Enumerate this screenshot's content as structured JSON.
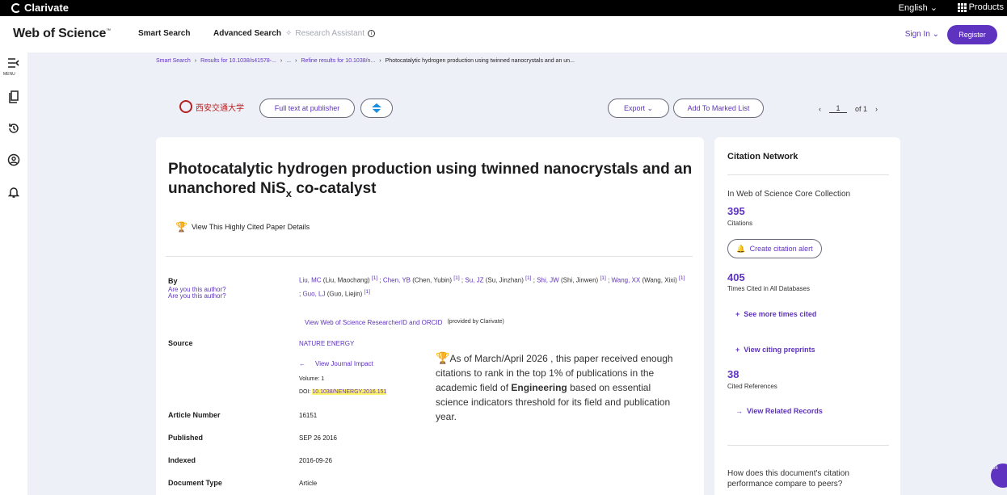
{
  "topbar": {
    "brand": "Clarivate",
    "language": "English",
    "products": "Products"
  },
  "header": {
    "logo": "Web of Science",
    "logo_tm": "™",
    "nav": [
      "Smart Search",
      "Advanced Search",
      "Research Assistant"
    ],
    "sign_in": "Sign In",
    "register": "Register"
  },
  "rail": {
    "menu_label": "MENU"
  },
  "breadcrumb": [
    "Smart Search",
    "Results for 10.1038/s41578-...",
    "...",
    "Refine results for 10.1038/n...",
    "Photocatalytic hydrogen production using twinned nanocrystals and an un..."
  ],
  "actions": {
    "university_logo": "西安交通大学",
    "full_text": "Full text at publisher",
    "export": "Export",
    "add_marked": "Add To Marked List",
    "page_current": "1",
    "page_total": "of 1"
  },
  "record": {
    "title_part1": "Photocatalytic hydrogen production using twinned nanocrystals and an unanchored NiS",
    "title_sub": "x",
    "title_part2": " co-catalyst",
    "highly_cited_link": "View This Highly Cited Paper Details",
    "by_label": "By",
    "are_you_author": "Are you this author?",
    "authors": [
      {
        "abbr": "Liu, MC",
        "full": "(Liu, Maochang)",
        "ref": "[1]"
      },
      {
        "abbr": "Chen, YB",
        "full": "(Chen, Yubin)",
        "ref": "[1]"
      },
      {
        "abbr": "Su, JZ",
        "full": "(Su, Jinzhan)",
        "ref": "[1]"
      },
      {
        "abbr": "Shi, JW",
        "full": "(Shi, Jinwen)",
        "ref": "[1]"
      },
      {
        "abbr": "Wang, XX",
        "full": "(Wang, Xixi)",
        "ref": "[1]"
      },
      {
        "abbr": "Guo, LJ",
        "full": "(Guo, Liejin)",
        "ref": "[1]"
      }
    ],
    "researcher_id_link": "View Web of Science ResearcherID and ORCID",
    "provided_by": "(provided by Clarivate)",
    "source_label": "Source",
    "source_name": "NATURE ENERGY",
    "journal_impact": "View Journal Impact",
    "volume": "Volume: 1",
    "doi_label": "DOI:",
    "doi_value": "10.1038/NENERGY.2016.151",
    "article_number_label": "Article Number",
    "article_number": "16151",
    "published_label": "Published",
    "published": "SEP 26 2016",
    "indexed_label": "Indexed",
    "indexed": "2016-09-26",
    "doctype_label": "Document Type",
    "doctype": "Article",
    "hc_note_pre": "As of March/April 2026 , this paper received enough citations to rank in the top 1% of publications in the academic field of ",
    "hc_note_field": "Engineering",
    "hc_note_post": " based on essential science indicators threshold for its field and publication year."
  },
  "citation_network": {
    "heading": "Citation Network",
    "core_collection": "In Web of Science Core Collection",
    "citations_count": "395",
    "citations_label": "Citations",
    "create_alert": "Create citation alert",
    "all_db_count": "405",
    "all_db_label": "Times Cited in All Databases",
    "see_more": "See more times cited",
    "citing_preprints": "View citing preprints",
    "cited_refs_count": "38",
    "cited_refs_label": "Cited References",
    "related_records": "View Related Records",
    "peer_question": "How does this document's citation performance compare to peers?"
  },
  "chat_badge": "36",
  "colors": {
    "accent": "#5e33bf",
    "highlight": "#fff36b",
    "trophy": "#c0141b"
  }
}
